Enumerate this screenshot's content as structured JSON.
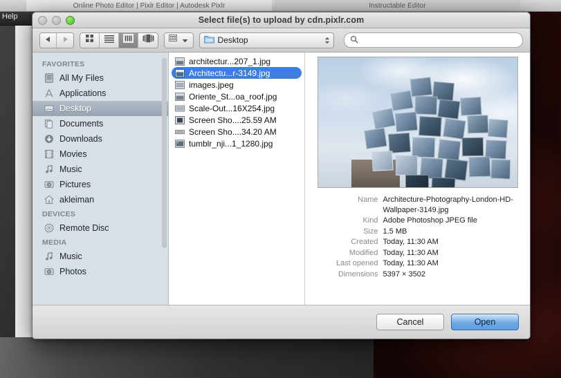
{
  "background": {
    "browser_tabs": [
      {
        "label": "Online Photo Editor | Pixlr Editor | Autodesk Pixlr",
        "active": true
      },
      {
        "label": "Instructable Editor",
        "active": false
      }
    ],
    "menu_help": "Help"
  },
  "dialog": {
    "title": "Select file(s) to upload by cdn.pixlr.com",
    "window_controls": {
      "close": "close-button",
      "minimize": "minimize-button",
      "zoom": "zoom-button"
    },
    "toolbar": {
      "back_icon": "back-arrow-icon",
      "forward_icon": "forward-arrow-icon",
      "view_icon_grid": "icon-view-icon",
      "view_list": "list-view-icon",
      "view_column": "column-view-icon",
      "view_coverflow": "coverflow-view-icon",
      "active_view": "column",
      "arrange_icon": "arrange-grid-icon",
      "path_label": "Desktop",
      "path_icon": "folder-icon",
      "search_placeholder": "",
      "search_value": "",
      "search_icon": "search-icon"
    },
    "sidebar": {
      "sections": [
        {
          "header": "FAVORITES",
          "items": [
            {
              "label": "All My Files",
              "icon": "all-my-files-icon",
              "selected": false
            },
            {
              "label": "Applications",
              "icon": "applications-icon",
              "selected": false
            },
            {
              "label": "Desktop",
              "icon": "desktop-folder-icon",
              "selected": true
            },
            {
              "label": "Documents",
              "icon": "documents-folder-icon",
              "selected": false
            },
            {
              "label": "Downloads",
              "icon": "downloads-folder-icon",
              "selected": false
            },
            {
              "label": "Movies",
              "icon": "movies-folder-icon",
              "selected": false
            },
            {
              "label": "Music",
              "icon": "music-folder-icon",
              "selected": false
            },
            {
              "label": "Pictures",
              "icon": "pictures-folder-icon",
              "selected": false
            },
            {
              "label": "akleiman",
              "icon": "home-folder-icon",
              "selected": false
            }
          ]
        },
        {
          "header": "DEVICES",
          "items": [
            {
              "label": "Remote Disc",
              "icon": "remote-disc-icon",
              "selected": false
            }
          ]
        },
        {
          "header": "MEDIA",
          "items": [
            {
              "label": "Music",
              "icon": "music-media-icon",
              "selected": false
            },
            {
              "label": "Photos",
              "icon": "photos-media-icon",
              "selected": false
            }
          ]
        }
      ]
    },
    "file_list": [
      {
        "name": "architectur...207_1.jpg",
        "icon": "jpeg-file-icon",
        "selected": false
      },
      {
        "name": "Architectu...r-3149.jpg",
        "icon": "jpeg-file-icon",
        "selected": true
      },
      {
        "name": "images.jpeg",
        "icon": "jpeg-file-icon",
        "selected": false
      },
      {
        "name": "Oriente_St...oa_roof.jpg",
        "icon": "jpeg-file-icon",
        "selected": false
      },
      {
        "name": "Scale-Out...16X254.jpg",
        "icon": "jpeg-file-icon",
        "selected": false
      },
      {
        "name": "Screen Sho....25.59 AM",
        "icon": "png-file-icon",
        "selected": false
      },
      {
        "name": "Screen Sho....34.20 AM",
        "icon": "png-file-icon",
        "selected": false
      },
      {
        "name": "tumblr_nji...1_1280.jpg",
        "icon": "jpeg-file-icon",
        "selected": false
      }
    ],
    "preview": {
      "image_alt": "architecture-photograph-preview",
      "metadata": [
        {
          "label": "Name",
          "value": "Architecture-Photography-London-HD-Wallpaper-3149.jpg"
        },
        {
          "label": "Kind",
          "value": "Adobe Photoshop JPEG file"
        },
        {
          "label": "Size",
          "value": "1.5 MB"
        },
        {
          "label": "Created",
          "value": "Today, 11:30 AM"
        },
        {
          "label": "Modified",
          "value": "Today, 11:30 AM"
        },
        {
          "label": "Last opened",
          "value": "Today, 11:30 AM"
        },
        {
          "label": "Dimensions",
          "value": "5397 × 3502"
        }
      ]
    },
    "footer": {
      "cancel_label": "Cancel",
      "open_label": "Open"
    }
  },
  "colors": {
    "selection_blue": "#3c7fe0",
    "primary_button": "#6fa9e4",
    "sidebar_bg": "#d9dfe6",
    "zoom_green": "#49b72b"
  }
}
